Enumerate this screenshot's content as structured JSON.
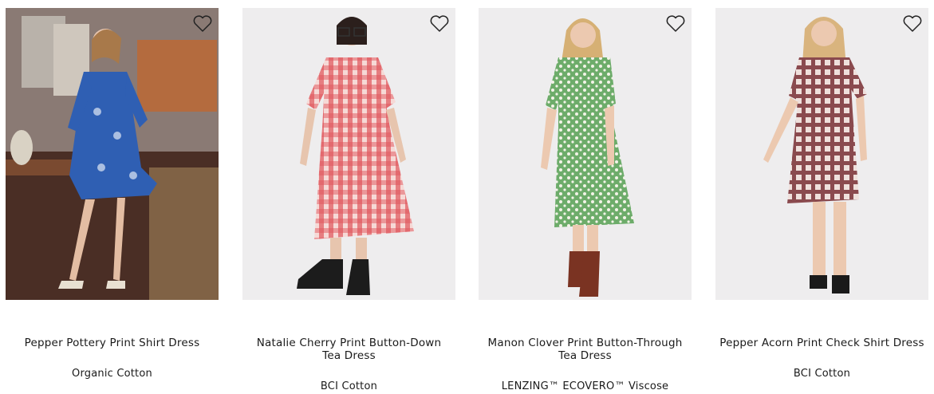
{
  "products": [
    {
      "name": "Pepper Pottery Print Shirt Dress",
      "material": "Organic Cotton",
      "wishlist_icon": "heart-outline-icon"
    },
    {
      "name": "Natalie Cherry Print Button-Down Tea Dress",
      "material": "BCI Cotton",
      "wishlist_icon": "heart-outline-icon"
    },
    {
      "name": "Manon Clover Print Button-Through Tea Dress",
      "material": "LENZING™ ECOVERO™ Viscose",
      "wishlist_icon": "heart-outline-icon"
    },
    {
      "name": "Pepper Acorn Print Check Shirt Dress",
      "material": "BCI Cotton",
      "wishlist_icon": "heart-outline-icon"
    }
  ],
  "colors": {
    "dress_blue": "#2f5fb3",
    "dress_red_check": "#e0565b",
    "dress_green": "#6dac6a",
    "dress_brown_check": "#8a4a4e",
    "studio_bg": "#eeedee",
    "kitchen_bg": "#6e5a52"
  }
}
